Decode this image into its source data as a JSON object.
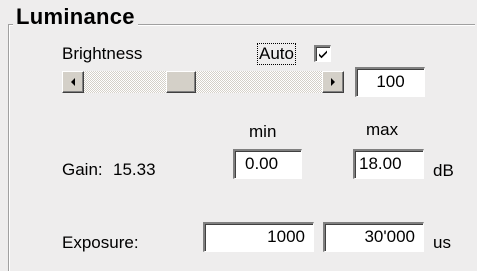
{
  "group": {
    "title": "Luminance"
  },
  "brightness": {
    "label": "Brightness",
    "auto_label": "Auto",
    "auto_checked": true,
    "slider_value": "100"
  },
  "gain": {
    "min_header": "min",
    "max_header": "max",
    "label": "Gain:",
    "value": "15.33",
    "min": "0.00",
    "max": "18.00",
    "unit": "dB"
  },
  "exposure": {
    "label": "Exposure:",
    "min": "1000",
    "max": "30'000",
    "unit": "us"
  },
  "icons": {
    "scroll_left": "left-arrow-icon",
    "scroll_right": "right-arrow-icon",
    "check": "checkmark-icon"
  }
}
